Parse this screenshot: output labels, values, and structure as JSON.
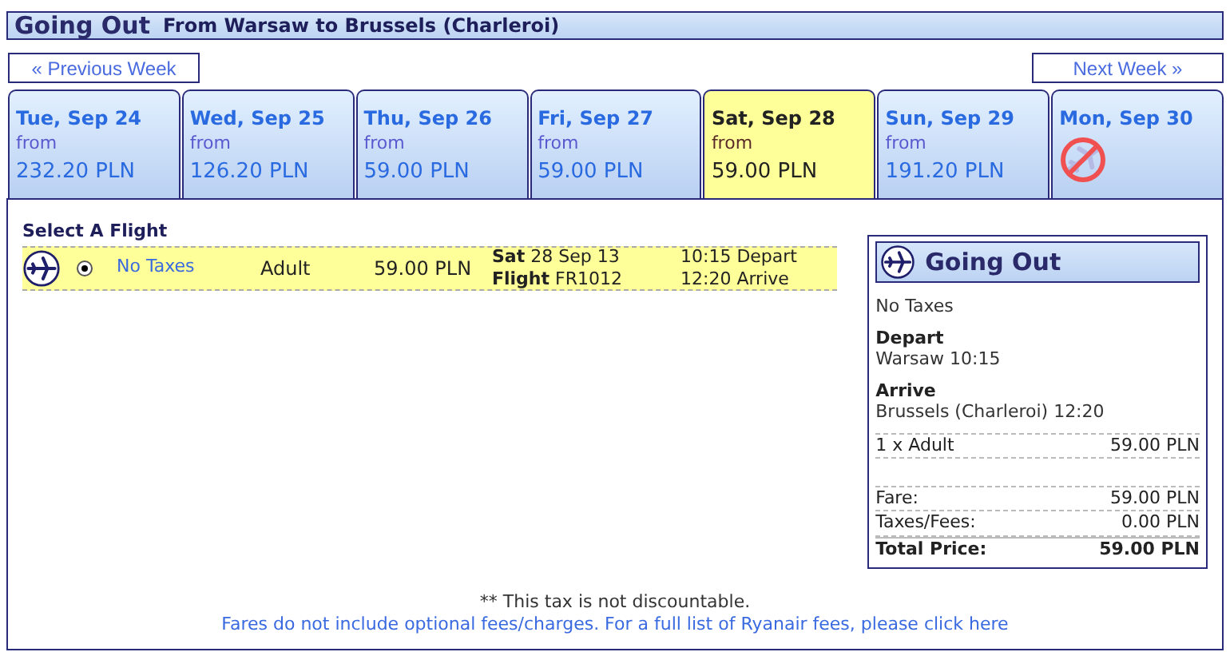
{
  "header": {
    "title": "Going Out",
    "route": "From Warsaw to Brussels (Charleroi)"
  },
  "week_nav": {
    "previous": "« Previous Week",
    "next": "Next Week »"
  },
  "days": [
    {
      "date": "Tue, Sep 24",
      "kind": "fare",
      "from": "from",
      "price": "232.20 PLN",
      "selected": false
    },
    {
      "date": "Wed, Sep 25",
      "kind": "fare",
      "from": "from",
      "price": "126.20 PLN",
      "selected": false
    },
    {
      "date": "Thu, Sep 26",
      "kind": "fare",
      "from": "from",
      "price": "59.00 PLN",
      "selected": false
    },
    {
      "date": "Fri, Sep 27",
      "kind": "fare",
      "from": "from",
      "price": "59.00 PLN",
      "selected": false
    },
    {
      "date": "Sat, Sep 28",
      "kind": "fare",
      "from": "from",
      "price": "59.00 PLN",
      "selected": true
    },
    {
      "date": "Sun, Sep 29",
      "kind": "fare",
      "from": "from",
      "price": "191.20 PLN",
      "selected": false
    },
    {
      "date": "Mon, Sep 30",
      "kind": "no_flights",
      "selected": false
    }
  ],
  "flights": {
    "heading": "Select A Flight",
    "rows": [
      {
        "selected": true,
        "fare_type": "No Taxes",
        "passenger": "Adult",
        "price": "59.00 PLN",
        "date": "**Sat** 28 Sep 13",
        "flight": "**Flight** FR1012",
        "depart": "10:15 Depart",
        "arrive": "12:20 Arrive"
      }
    ]
  },
  "summary": {
    "title": "Going Out",
    "fare_type": "No Taxes",
    "depart_label": "Depart",
    "depart_value": "Warsaw 10:15",
    "arrive_label": "Arrive",
    "arrive_value": "Brussels (Charleroi) 12:20",
    "lines": [
      {
        "kind": "item",
        "label": "1 x Adult",
        "value": "59.00 PLN"
      },
      {
        "kind": "item",
        "label": "Fare:",
        "value": "59.00 PLN"
      },
      {
        "kind": "item",
        "label": "Taxes/Fees:",
        "value": "0.00 PLN"
      },
      {
        "kind": "total",
        "label": "Total Price:",
        "value": "59.00 PLN"
      }
    ]
  },
  "footer": {
    "note": "** This tax is not discountable.",
    "link": "Fares do not include optional fees/charges. For a full list of Ryanair fees, please click here"
  }
}
